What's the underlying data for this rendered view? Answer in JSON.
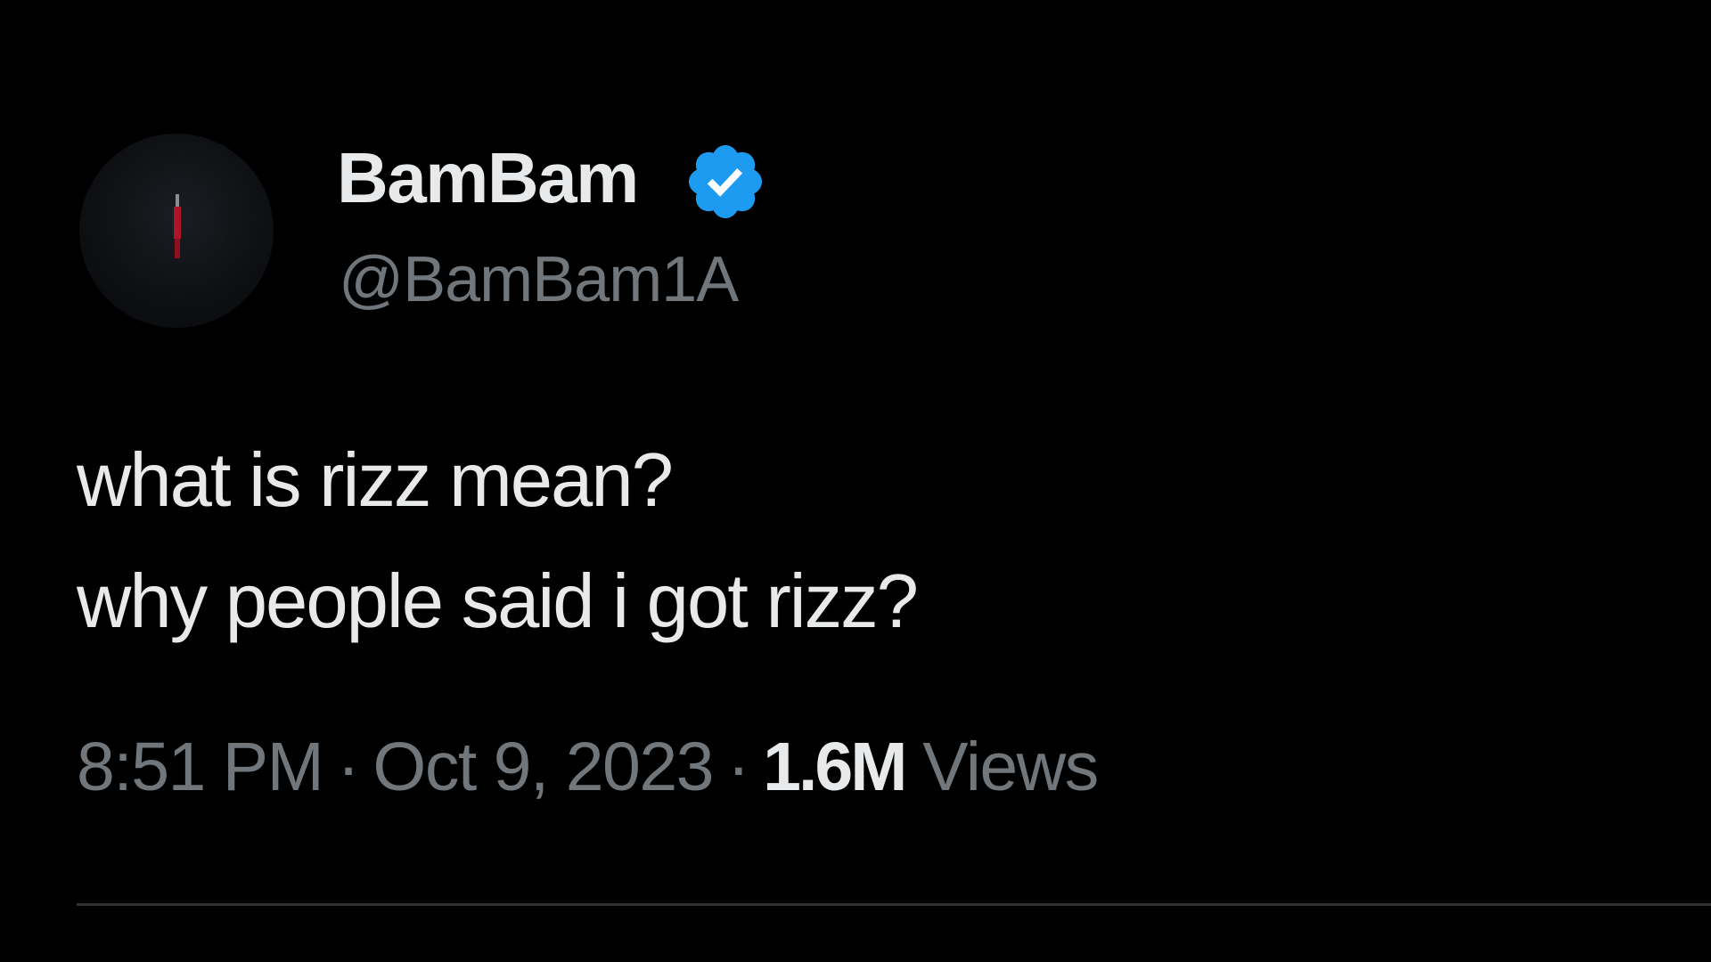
{
  "author": {
    "display_name": "BamBam",
    "handle": "@BamBam1A",
    "verified": true,
    "verified_icon": "verified-badge-icon",
    "verified_color": "#1d9bf0"
  },
  "tweet": {
    "lines": [
      "what is rizz mean?",
      "why people said i got rizz?"
    ],
    "time": "8:51 PM",
    "date": "Oct 9, 2023",
    "separator": "·",
    "views_count": "1.6M",
    "views_label": "Views"
  },
  "colors": {
    "background": "#000000",
    "primary_text": "#e7e9ea",
    "secondary_text": "#71767b",
    "divider": "#2f3336"
  }
}
